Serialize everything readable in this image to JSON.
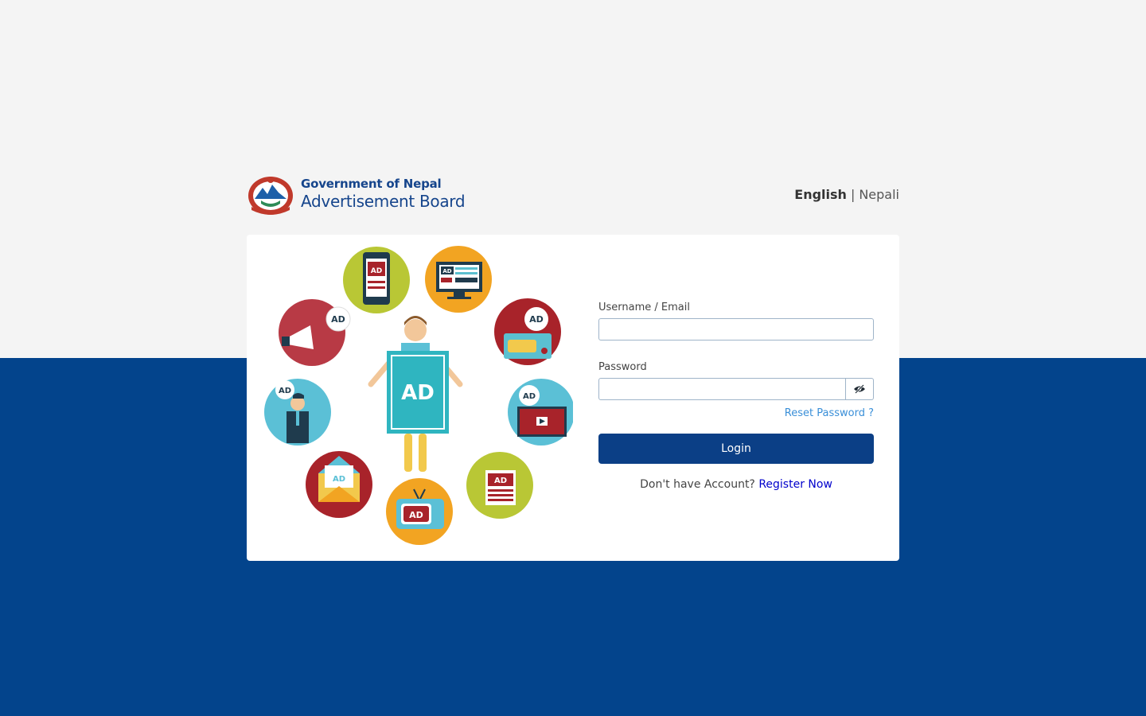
{
  "brand": {
    "line1": "Government of Nepal",
    "line2": "Advertisement Board",
    "color": "#16458c"
  },
  "language": {
    "english": "English",
    "separator": "|",
    "nepali": "Nepali",
    "selected": "English"
  },
  "illustration": {
    "center_badge": "AD",
    "badge": "AD"
  },
  "login_form": {
    "username_label": "Username / Email",
    "username_value": "",
    "password_label": "Password",
    "password_value": "",
    "reset_link": "Reset Password ?",
    "login_button": "Login",
    "register_prompt": "Don't have Account?",
    "register_link": "Register Now"
  },
  "colors": {
    "top_background": "#f4f4f4",
    "bottom_background": "#03448c",
    "primary_button": "#0b3f86",
    "link": "#3a8fd8",
    "register_link": "#0000cc"
  }
}
